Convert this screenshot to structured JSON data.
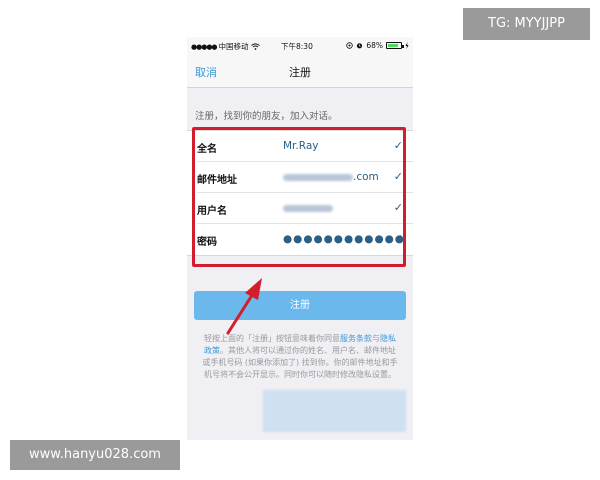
{
  "status_bar": {
    "signal_dots": "●●●●●",
    "carrier": "中国移动",
    "time": "下午8:30",
    "battery_percent": "68%",
    "battery_level": 0.68
  },
  "nav": {
    "cancel": "取消",
    "title": "注册"
  },
  "intro": "注册，找到你的朋友，加入对话。",
  "form": {
    "rows": [
      {
        "label": "全名",
        "value": "Mr.Ray"
      },
      {
        "label": "邮件地址",
        "value_suffix": ".com"
      },
      {
        "label": "用户名"
      },
      {
        "label": "密码",
        "value": "●●●●●●●●●●●●"
      }
    ],
    "check": "✓"
  },
  "register_button": "注册",
  "terms": {
    "part1": "轻按上面的「注册」按钮意味着你同意",
    "link1": "服务条款",
    "part2": "与",
    "link2": "隐私政策",
    "part3": "。其他人将可以通过你的姓名、用户名、邮件地址或手机号码 (如果你添加了) 找到你。你的邮件地址和手机号将不会公开显示。同时你可以随时修改隐私设置。"
  },
  "watermarks": {
    "top": "TG: MYYJJPP",
    "bottom": "www.hanyu028.com"
  },
  "colors": {
    "highlight": "#d21e2c",
    "button": "#6bb8ec",
    "link": "#3a9ad9"
  }
}
